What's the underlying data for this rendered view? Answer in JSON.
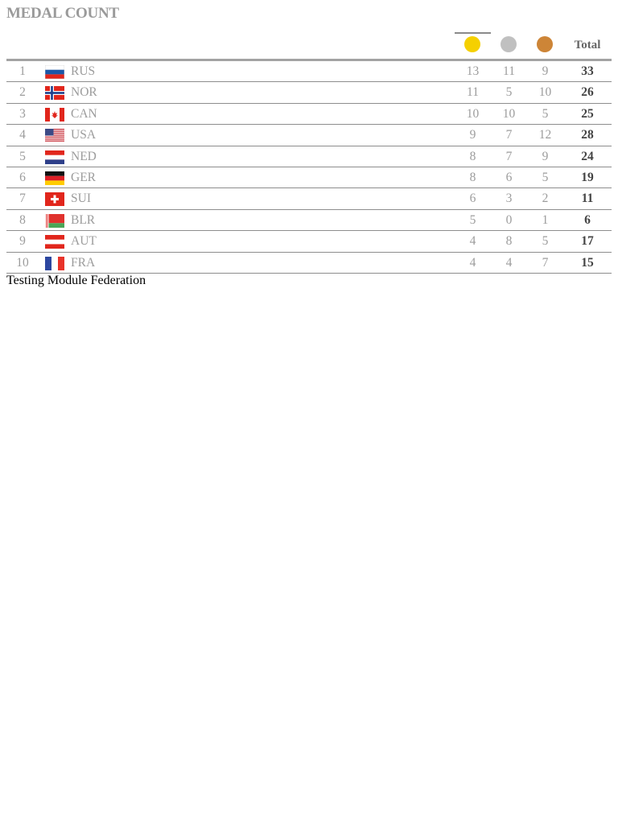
{
  "title": "MEDAL COUNT",
  "columns": {
    "gold_icon": "gold-medal-icon",
    "silver_icon": "silver-medal-icon",
    "bronze_icon": "bronze-medal-icon",
    "total_label": "Total"
  },
  "colors": {
    "gold": "#f5d000",
    "silver": "#c0c0c0",
    "bronze": "#cd8537"
  },
  "rows": [
    {
      "rank": "1",
      "code": "RUS",
      "gold": "13",
      "silver": "11",
      "bronze": "9",
      "total": "33"
    },
    {
      "rank": "2",
      "code": "NOR",
      "gold": "11",
      "silver": "5",
      "bronze": "10",
      "total": "26"
    },
    {
      "rank": "3",
      "code": "CAN",
      "gold": "10",
      "silver": "10",
      "bronze": "5",
      "total": "25"
    },
    {
      "rank": "4",
      "code": "USA",
      "gold": "9",
      "silver": "7",
      "bronze": "12",
      "total": "28"
    },
    {
      "rank": "5",
      "code": "NED",
      "gold": "8",
      "silver": "7",
      "bronze": "9",
      "total": "24"
    },
    {
      "rank": "6",
      "code": "GER",
      "gold": "8",
      "silver": "6",
      "bronze": "5",
      "total": "19"
    },
    {
      "rank": "7",
      "code": "SUI",
      "gold": "6",
      "silver": "3",
      "bronze": "2",
      "total": "11"
    },
    {
      "rank": "8",
      "code": "BLR",
      "gold": "5",
      "silver": "0",
      "bronze": "1",
      "total": "6"
    },
    {
      "rank": "9",
      "code": "AUT",
      "gold": "4",
      "silver": "8",
      "bronze": "5",
      "total": "17"
    },
    {
      "rank": "10",
      "code": "FRA",
      "gold": "4",
      "silver": "4",
      "bronze": "7",
      "total": "15"
    }
  ],
  "footer": "Testing Module Federation"
}
